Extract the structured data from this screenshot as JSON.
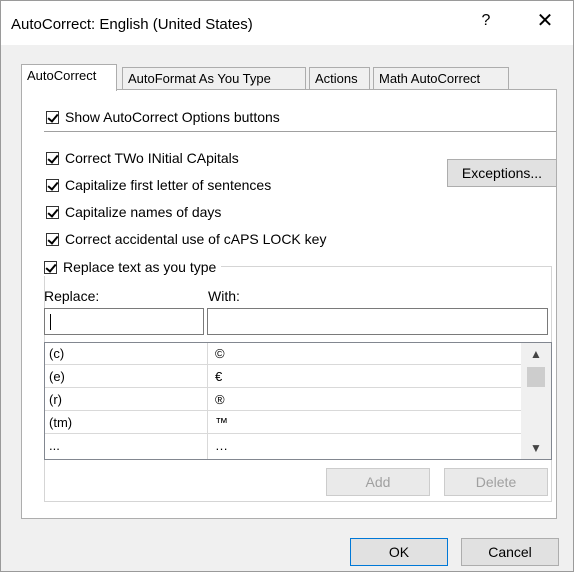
{
  "window": {
    "title": "AutoCorrect: English (United States)",
    "help_label": "?",
    "close_label": "✕"
  },
  "tabs": [
    {
      "label": "AutoCorrect",
      "active": true
    },
    {
      "label": "AutoFormat As You Type",
      "active": false
    },
    {
      "label": "Actions",
      "active": false
    },
    {
      "label": "Math AutoCorrect",
      "active": false
    }
  ],
  "options": {
    "show_buttons": {
      "label": "Show AutoCorrect Options buttons",
      "checked": true
    },
    "two_initials": {
      "label": "Correct TWo INitial CApitals",
      "checked": true
    },
    "first_letter": {
      "label": "Capitalize first letter of sentences",
      "checked": true
    },
    "days": {
      "label": "Capitalize names of days",
      "checked": true
    },
    "caps_lock": {
      "label": "Correct accidental use of cAPS LOCK key",
      "checked": true
    },
    "replace_text": {
      "label": "Replace text as you type",
      "checked": true
    }
  },
  "exceptions_label": "Exceptions...",
  "replace": {
    "replace_label": "Replace:",
    "with_label": "With:",
    "replace_value": "",
    "with_value": ""
  },
  "entries": [
    {
      "from": "(c)",
      "to": "©"
    },
    {
      "from": "(e)",
      "to": "€"
    },
    {
      "from": "(r)",
      "to": "®"
    },
    {
      "from": "(tm)",
      "to": "™"
    },
    {
      "from": "...",
      "to": "…"
    }
  ],
  "scroll": {
    "up_icon": "▲",
    "down_icon": "▼"
  },
  "buttons": {
    "add": "Add",
    "delete": "Delete",
    "ok": "OK",
    "cancel": "Cancel"
  }
}
